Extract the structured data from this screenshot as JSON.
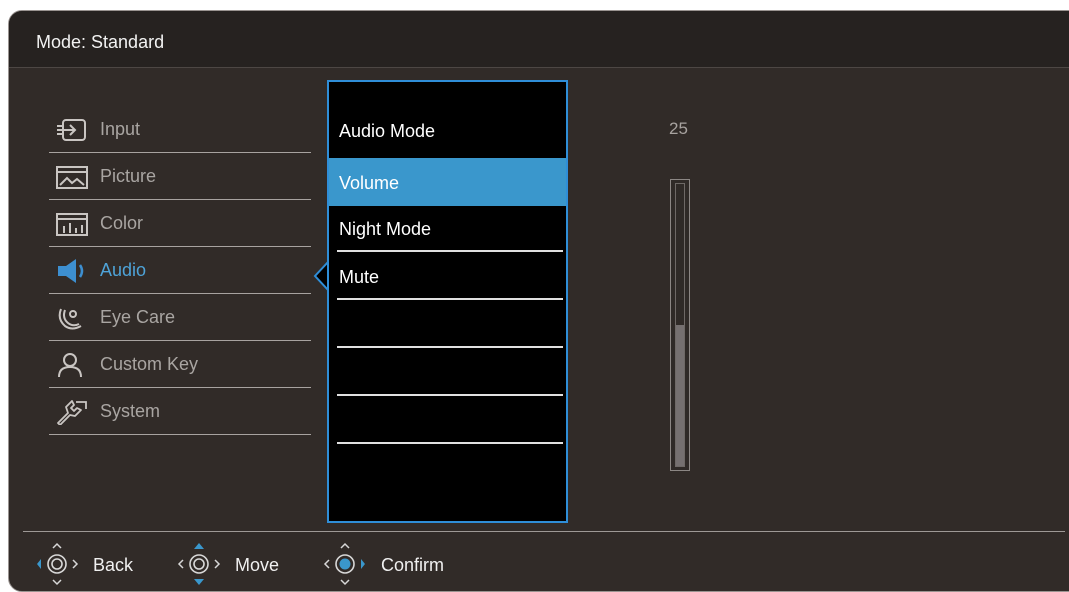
{
  "header": {
    "title": "Mode: Standard"
  },
  "menu": {
    "items": [
      {
        "label": "Input",
        "icon": "input-icon"
      },
      {
        "label": "Picture",
        "icon": "picture-icon"
      },
      {
        "label": "Color",
        "icon": "color-icon"
      },
      {
        "label": "Audio",
        "icon": "audio-icon",
        "active": true
      },
      {
        "label": "Eye Care",
        "icon": "eye-care-icon"
      },
      {
        "label": "Custom Key",
        "icon": "custom-key-icon"
      },
      {
        "label": "System",
        "icon": "system-icon"
      }
    ]
  },
  "submenu": {
    "items": [
      {
        "label": "Audio Mode"
      },
      {
        "label": "Volume",
        "selected": true
      },
      {
        "label": "Night Mode"
      },
      {
        "label": "Mute"
      }
    ]
  },
  "slider": {
    "value": "25",
    "level_percent": 50
  },
  "footer": {
    "back_label": "Back",
    "move_label": "Move",
    "confirm_label": "Confirm"
  },
  "colors": {
    "accent": "#3a97cc",
    "background": "#312b28",
    "title_bar": "#262220"
  }
}
